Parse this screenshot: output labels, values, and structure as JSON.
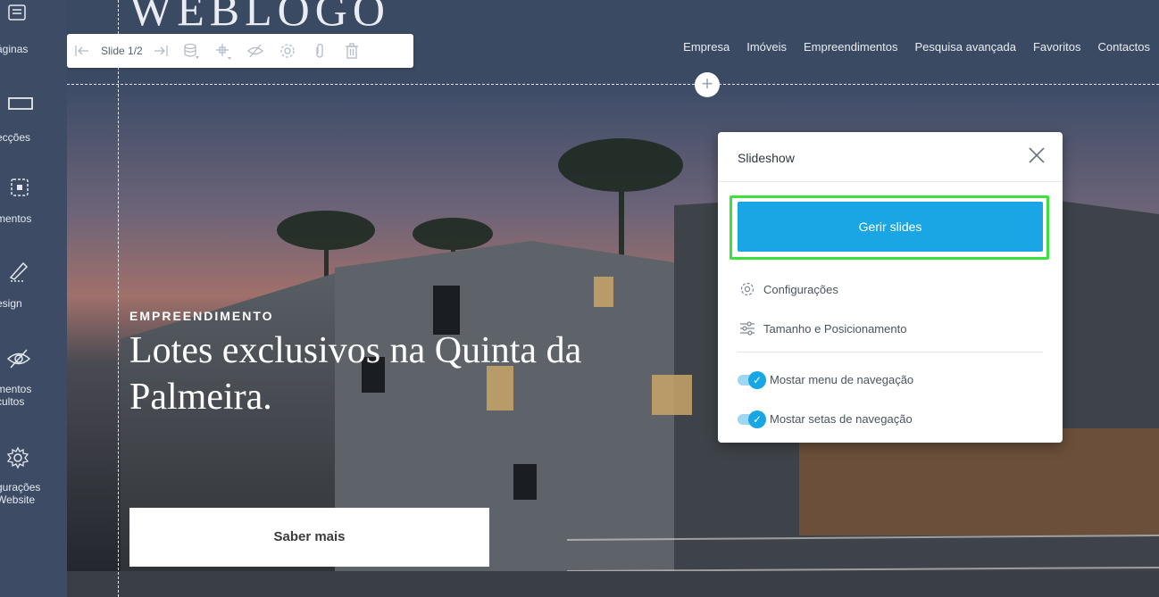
{
  "sidebar": {
    "items": [
      {
        "label": "áginas",
        "icon": "pages-icon"
      },
      {
        "label": "ecções",
        "icon": "sections-icon"
      },
      {
        "label": "mentos",
        "icon": "elements-icon"
      },
      {
        "label": "esign",
        "icon": "design-pencil-icon"
      },
      {
        "label": "mentos\ncultos",
        "icon": "hidden-eye-icon"
      },
      {
        "label": "gurações\nWebsite",
        "icon": "settings-gear-icon"
      }
    ]
  },
  "header": {
    "logo": "WEBLOGO",
    "nav": [
      "Empresa",
      "Imóveis",
      "Empreendimentos",
      "Pesquisa avançada",
      "Favoritos",
      "Contactos"
    ]
  },
  "toolbar": {
    "slide_label": "Slide 1/2"
  },
  "slide": {
    "kicker": "EMPREENDIMENTO",
    "headline": "Lotes exclusivos na Quinta da Palmeira.",
    "cta": "Saber mais"
  },
  "panel": {
    "title": "Slideshow",
    "manage_button": "Gerir slides",
    "options": [
      "Configurações",
      "Tamanho e Posicionamento"
    ],
    "toggles": [
      {
        "label": "Mostar menu de navegação",
        "on": true
      },
      {
        "label": "Mostar setas de navegação",
        "on": true
      }
    ]
  },
  "colors": {
    "sidebar": "#3d4c64",
    "accent": "#1aa6e4",
    "highlight": "#3ce23c"
  }
}
